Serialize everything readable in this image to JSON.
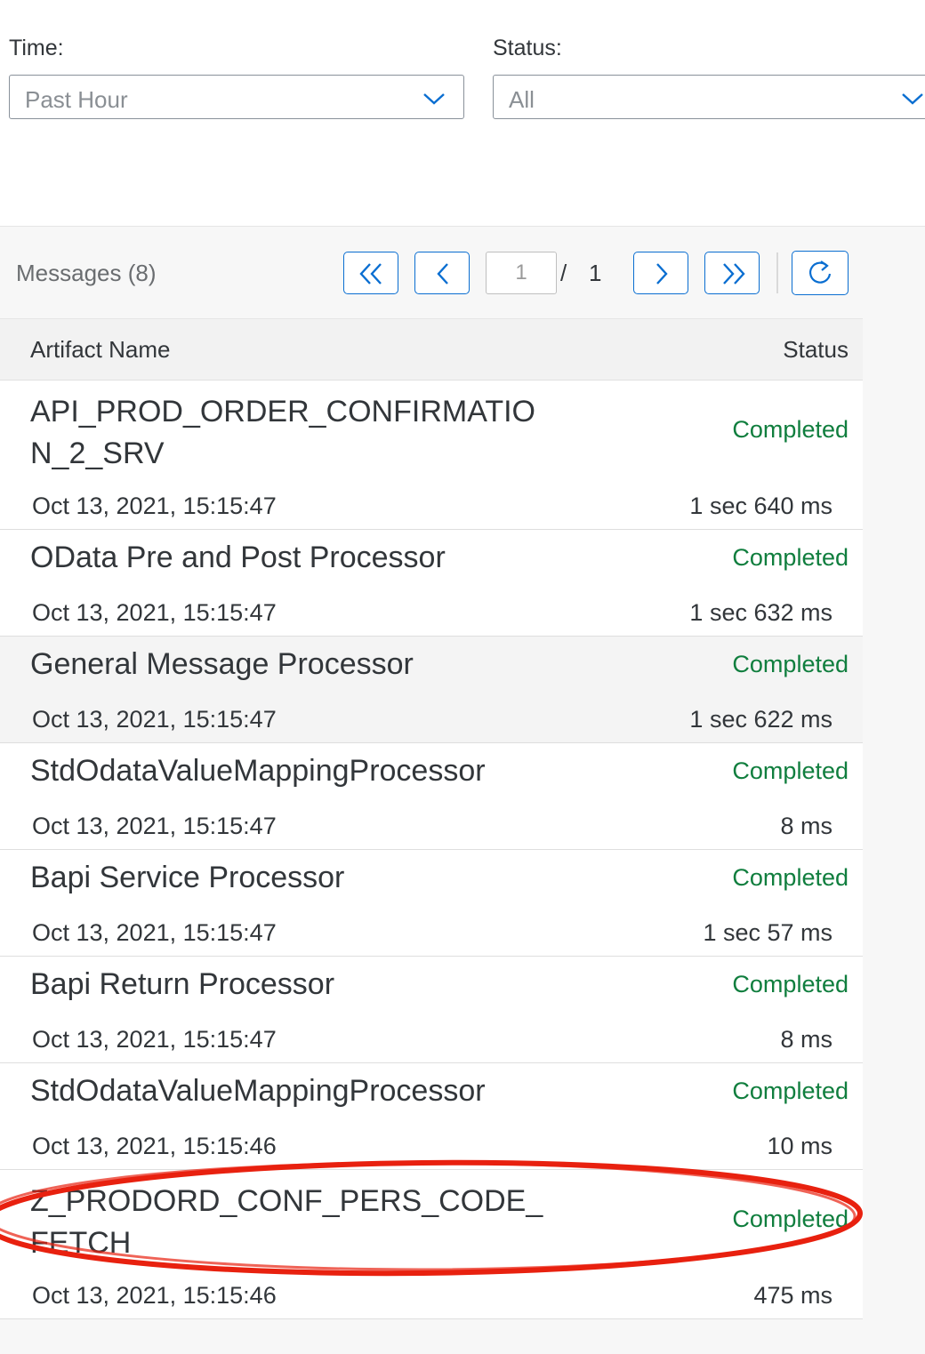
{
  "filters": {
    "time_label": "Time:",
    "time_value": "Past Hour",
    "status_label": "Status:",
    "status_value": "All"
  },
  "messages": {
    "title": "Messages (8)",
    "page_current": "1",
    "page_separator": "/",
    "page_total": "1",
    "columns": {
      "artifact_name": "Artifact Name",
      "status": "Status"
    },
    "rows": [
      {
        "name": "API_PROD_ORDER_CONFIRMATION_2_SRV",
        "status": "Completed",
        "date": "Oct 13, 2021, 15:15:47",
        "duration": "1 sec 640 ms"
      },
      {
        "name": "OData Pre and Post Processor",
        "status": "Completed",
        "date": "Oct 13, 2021, 15:15:47",
        "duration": "1 sec 632 ms"
      },
      {
        "name": "General Message Processor",
        "status": "Completed",
        "date": "Oct 13, 2021, 15:15:47",
        "duration": "1 sec 622 ms"
      },
      {
        "name": "StdOdataValueMappingProcessor",
        "status": "Completed",
        "date": "Oct 13, 2021, 15:15:47",
        "duration": "8 ms"
      },
      {
        "name": "Bapi Service Processor",
        "status": "Completed",
        "date": "Oct 13, 2021, 15:15:47",
        "duration": "1 sec 57 ms"
      },
      {
        "name": "Bapi Return Processor",
        "status": "Completed",
        "date": "Oct 13, 2021, 15:15:47",
        "duration": "8 ms"
      },
      {
        "name": "StdOdataValueMappingProcessor",
        "status": "Completed",
        "date": "Oct 13, 2021, 15:15:46",
        "duration": "10 ms"
      },
      {
        "name": "Z_PRODORD_CONF_PERS_CODE_FETCH",
        "status": "Completed",
        "date": "Oct 13, 2021, 15:15:46",
        "duration": "475 ms"
      }
    ]
  },
  "icons": {
    "time_dropdown": "chevron-down-icon",
    "status_dropdown": "chevron-down-icon",
    "first_page": "double-chevron-left-icon",
    "prev_page": "chevron-left-icon",
    "next_page": "chevron-right-icon",
    "last_page": "double-chevron-right-icon",
    "refresh": "refresh-icon"
  },
  "colors": {
    "accent": "#0a6ed1",
    "status_completed": "#107e3e",
    "annotation_red": "#e8210f"
  }
}
